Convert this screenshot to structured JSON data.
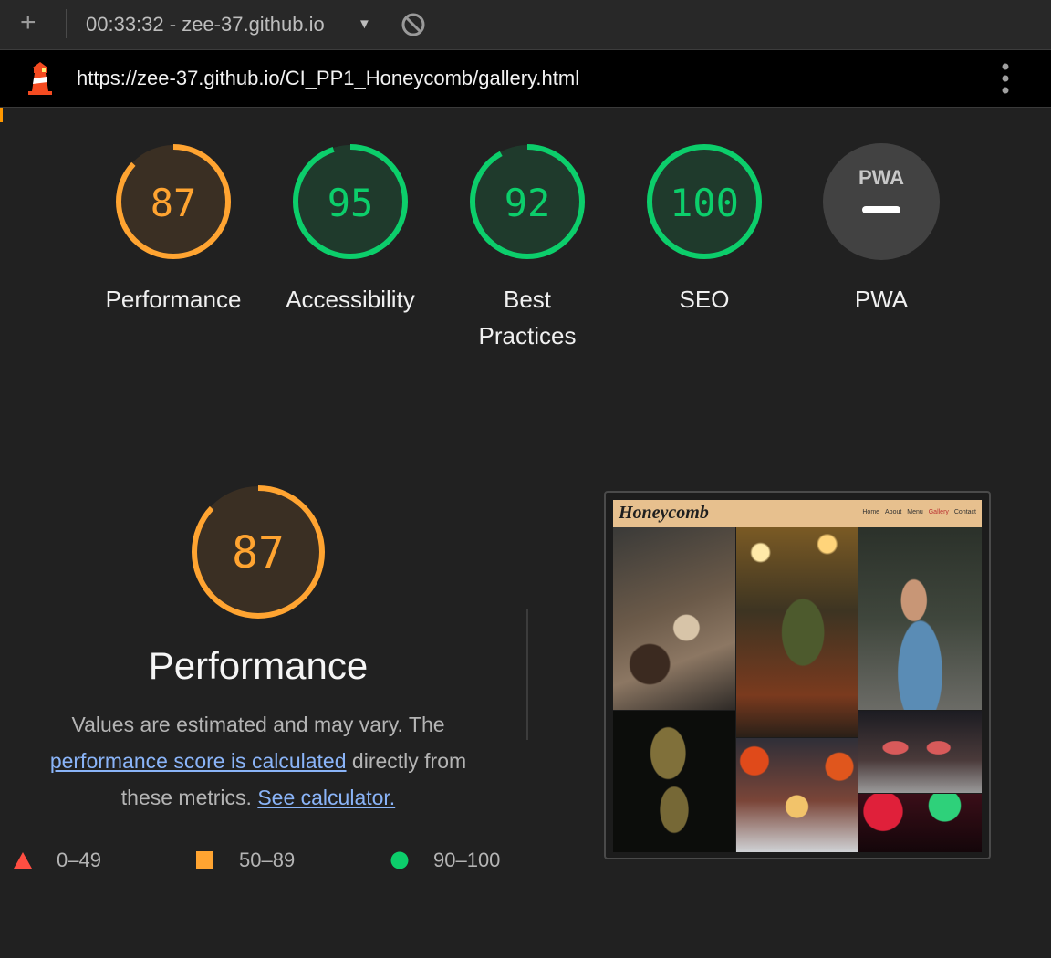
{
  "session": {
    "title": "00:33:32 - zee-37.github.io"
  },
  "url": "https://zee-37.github.io/CI_PP1_Honeycomb/gallery.html",
  "colors": {
    "orange": "#ffa431",
    "green": "#0cce6b",
    "red": "#ff4e42",
    "link": "#8ab4f8"
  },
  "gauges": [
    {
      "score": "87",
      "label": "Performance",
      "value": 87,
      "color": "#ffa431"
    },
    {
      "score": "95",
      "label": "Accessibility",
      "value": 95,
      "color": "#0cce6b"
    },
    {
      "score": "92",
      "label": "Best Practices",
      "label_line1": "Best",
      "label_line2": "Practices",
      "value": 92,
      "color": "#0cce6b"
    },
    {
      "score": "100",
      "label": "SEO",
      "value": 100,
      "color": "#0cce6b"
    },
    {
      "badge": "PWA",
      "label": "PWA"
    }
  ],
  "performance": {
    "score": "87",
    "title": "Performance",
    "desc_part1": "Values are estimated and may vary. The ",
    "desc_link1": "performance score is calculated",
    "desc_part2": " directly from these metrics. ",
    "desc_link2": "See calculator."
  },
  "legend": [
    {
      "range": "0–49",
      "shape": "triangle"
    },
    {
      "range": "50–89",
      "shape": "square"
    },
    {
      "range": "90–100",
      "shape": "circle"
    }
  ],
  "thumbnail": {
    "brand": "Honeycomb",
    "nav": [
      "Home",
      "About",
      "Menu",
      "Gallery",
      "Contact"
    ],
    "active_nav": "Gallery"
  }
}
